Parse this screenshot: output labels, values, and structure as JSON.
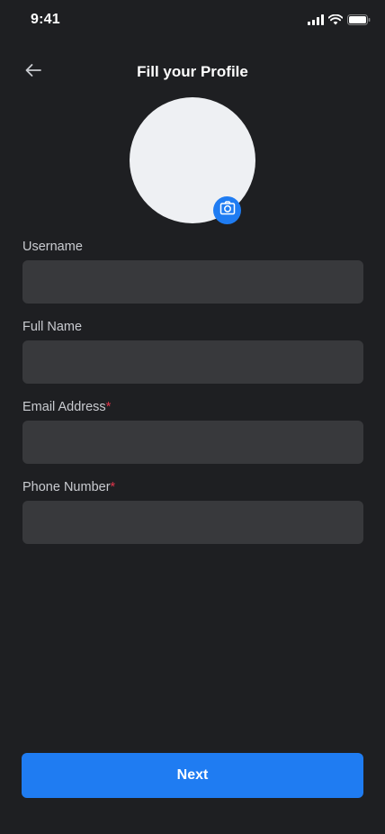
{
  "status_bar": {
    "time": "9:41"
  },
  "header": {
    "title": "Fill your Profile"
  },
  "form": {
    "username": {
      "label": "Username",
      "value": "",
      "required": false
    },
    "full_name": {
      "label": "Full Name",
      "value": "",
      "required": false
    },
    "email": {
      "label": "Email Address",
      "required_mark": "*",
      "value": ""
    },
    "phone": {
      "label": "Phone Number",
      "required_mark": "*",
      "value": ""
    }
  },
  "actions": {
    "next_label": "Next"
  },
  "icons": {
    "back": "arrow-left-icon",
    "camera": "camera-icon",
    "signal": "cellular-signal-icon",
    "wifi": "wifi-icon",
    "battery": "battery-icon"
  },
  "colors": {
    "background": "#1e1f22",
    "input_background": "#38393c",
    "accent": "#1f7cf2",
    "required": "#e0354b",
    "avatar_placeholder": "#eef0f3"
  }
}
